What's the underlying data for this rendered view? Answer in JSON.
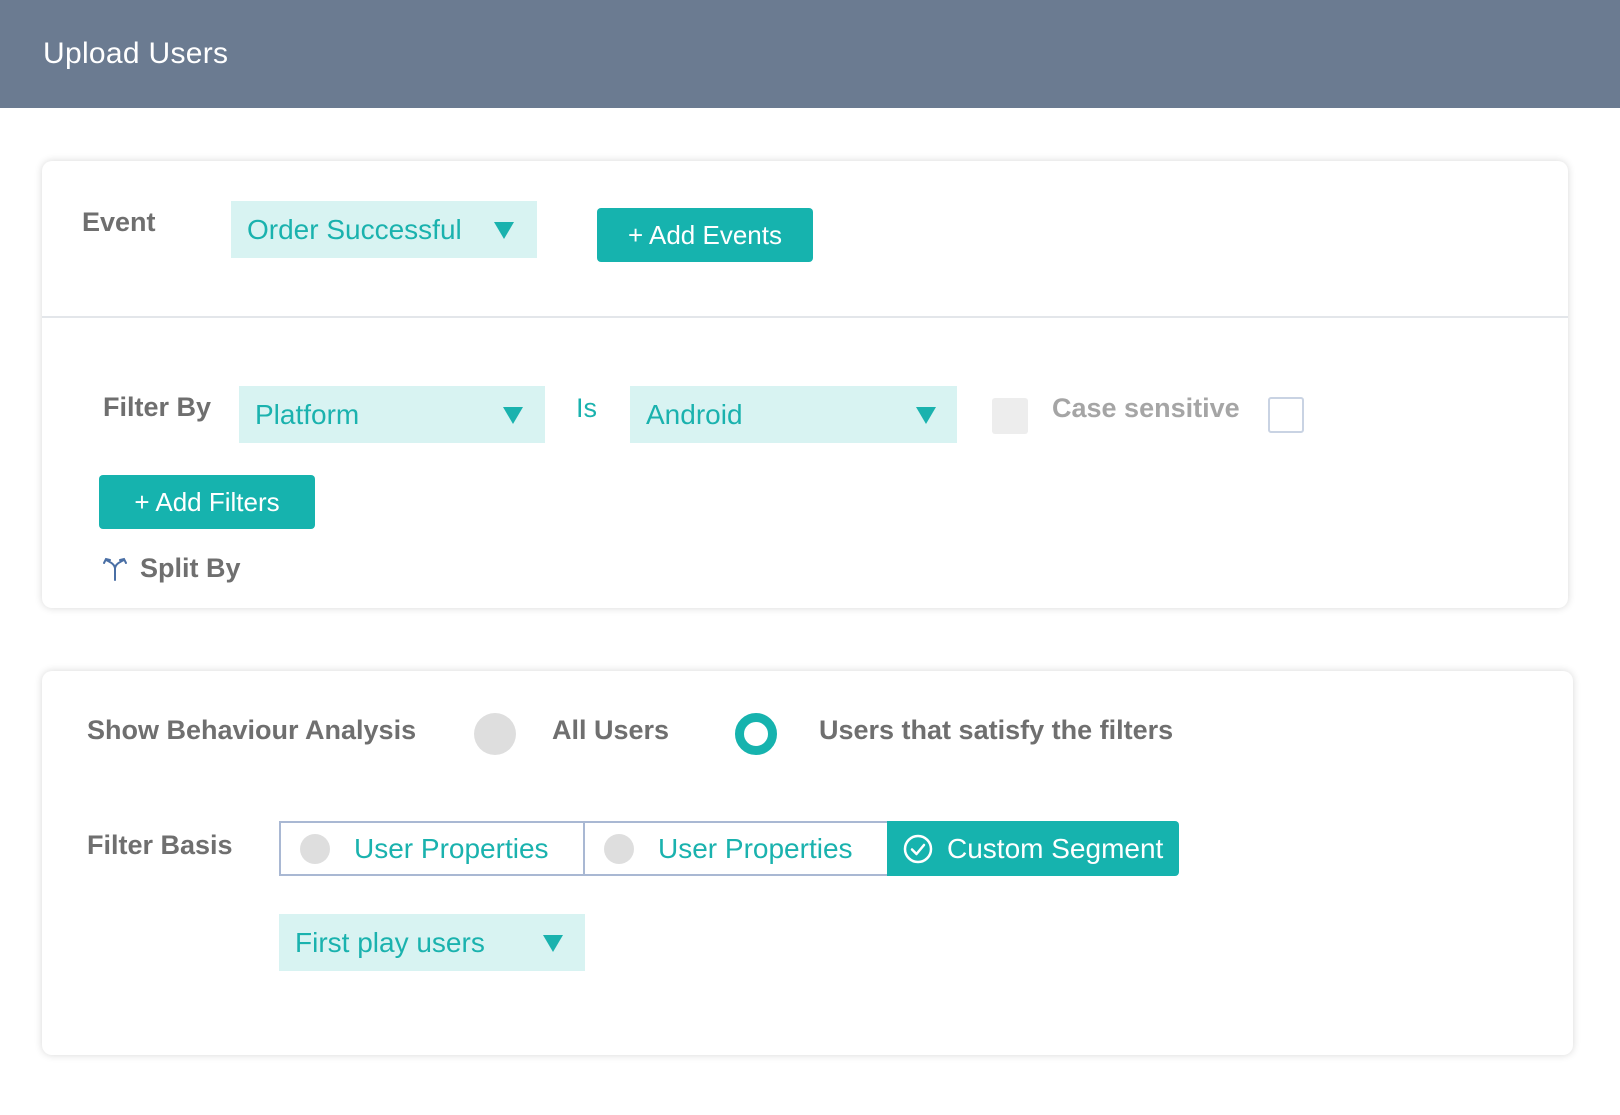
{
  "header": {
    "title": "Upload Users"
  },
  "event_section": {
    "label": "Event",
    "event_dropdown": "Order Successful",
    "add_events_button": "+ Add Events"
  },
  "filter_section": {
    "label": "Filter By",
    "property_dropdown": "Platform",
    "operator": "Is",
    "value_dropdown": "Android",
    "case_sensitive_label": "Case sensitive",
    "add_filters_button": "+ Add Filters",
    "split_by_label": "Split By"
  },
  "behaviour_section": {
    "label": "Show Behaviour Analysis",
    "option_all_users": "All Users",
    "option_filtered_users": "Users that satisfy the filters",
    "selected_option": "Users that satisfy the filters"
  },
  "filter_basis": {
    "label": "Filter Basis",
    "options": [
      "User Properties",
      "User Properties",
      "Custom Segment"
    ],
    "selected": "Custom Segment",
    "segment_dropdown": "First play users"
  },
  "colors": {
    "header_bg": "#6b7b91",
    "accent": "#16b3ae",
    "dropdown_bg": "#d8f3f2"
  }
}
